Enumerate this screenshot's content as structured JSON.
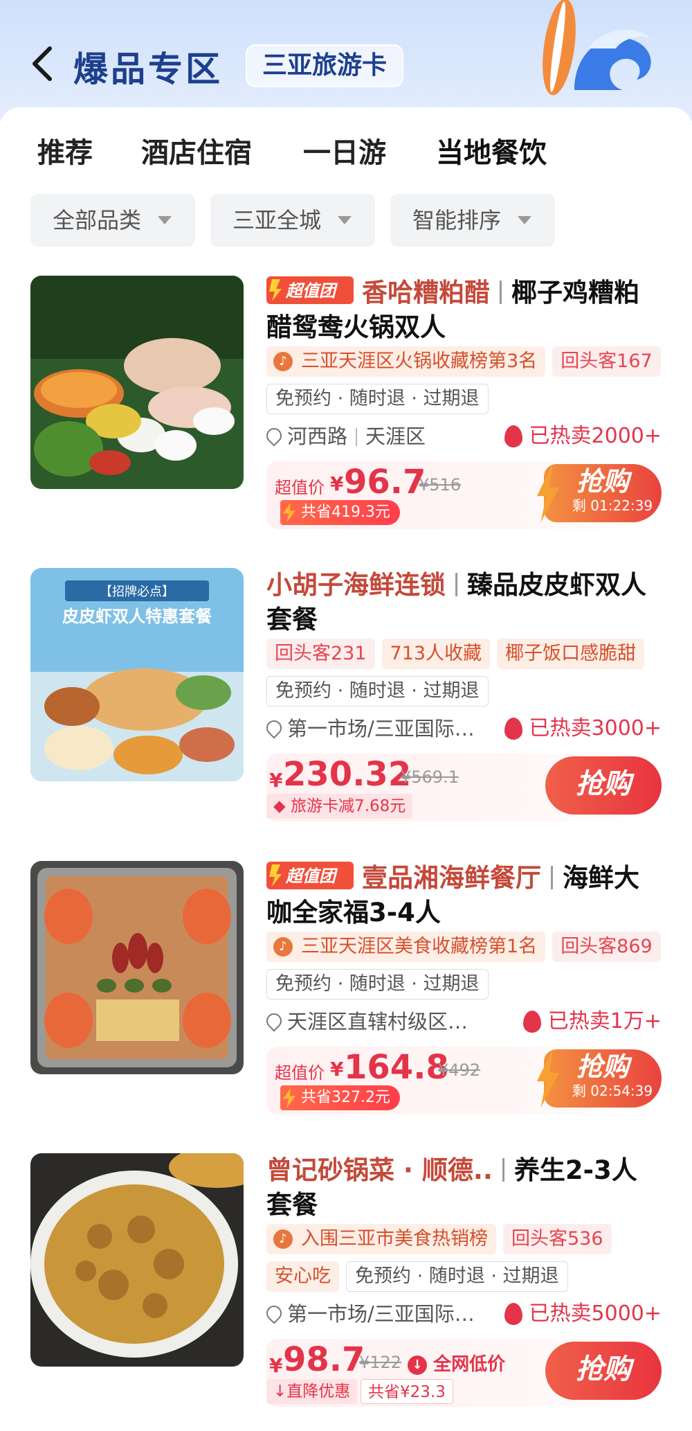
{
  "header": {
    "title": "爆品专区",
    "card_label": "三亚旅游卡"
  },
  "tabs": [
    "推荐",
    "酒店住宿",
    "一日游",
    "当地餐饮"
  ],
  "filters": [
    "全部品类",
    "三亚全城",
    "智能排序"
  ],
  "colors": {
    "accent": "#e3344a",
    "brand_blue": "#1d3f8e",
    "underline": "#f5607a"
  },
  "items": [
    {
      "badge": "超值团",
      "shop": "香哈糟粕醋",
      "name": "椰子鸡糟粕醋鸳鸯火锅双人",
      "tags": [
        "三亚天涯区火锅收藏榜第3名",
        "回头客167"
      ],
      "service": "免预约 · 随时退 · 过期退",
      "loc1": "河西路",
      "loc2": "天涯区",
      "sold": "已热卖2000+",
      "price_label": "超值价",
      "yen": "¥",
      "price": "96.7",
      "orig": "¥516",
      "save": "共省419.3元",
      "buy": "抢购",
      "timer": "剩 01:22:39"
    },
    {
      "shop": "小胡子海鲜连锁",
      "name": "臻品皮皮虾双人套餐",
      "tags": [
        "回头客231",
        "713人收藏",
        "椰子饭口感脆甜"
      ],
      "service": "免预约 · 随时退 · 过期退",
      "loc": "第一市场/三亚国际…",
      "sold": "已热卖3000+",
      "yen": "¥",
      "price": "230.32",
      "orig": "¥569.1",
      "discount": "旅游卡减7.68元",
      "buy": "抢购"
    },
    {
      "badge": "超值团",
      "shop": "壹品湘海鲜餐厅",
      "name": "海鲜大咖全家福3-4人",
      "tags": [
        "三亚天涯区美食收藏榜第1名",
        "回头客869"
      ],
      "service": "免预约 · 随时退 · 过期退",
      "loc": "天涯区直辖村级区…",
      "sold": "已热卖1万+",
      "price_label": "超值价",
      "yen": "¥",
      "price": "164.8",
      "orig": "¥492",
      "save": "共省327.2元",
      "buy": "抢购",
      "timer": "剩 02:54:39"
    },
    {
      "shop": "曾记砂锅菜 · 顺德..",
      "name": "养生2-3人套餐",
      "tags": [
        "入围三亚市美食热销榜",
        "回头客536"
      ],
      "tag_safe": "安心吃",
      "service": "免预约 · 随时退 · 过期退",
      "loc": "第一市场/三亚国际…",
      "sold": "已热卖5000+",
      "yen": "¥",
      "price": "98.7",
      "orig": "¥122",
      "lowest": "全网低价",
      "drop": "直降优惠",
      "saved": "共省¥23.3",
      "buy": "抢购"
    }
  ]
}
